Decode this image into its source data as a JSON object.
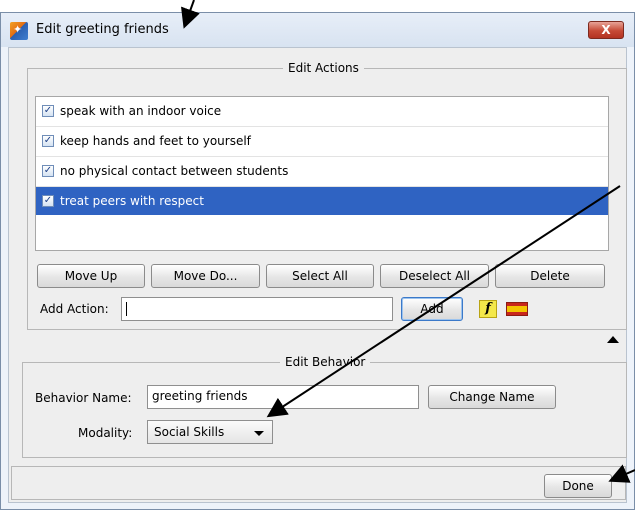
{
  "window": {
    "title": "Edit greeting friends",
    "close_label": "X"
  },
  "edit_actions": {
    "legend": "Edit Actions",
    "items": [
      {
        "label": "speak with an indoor voice",
        "checked": true,
        "selected": false
      },
      {
        "label": "keep hands and feet to yourself",
        "checked": true,
        "selected": false
      },
      {
        "label": "no physical contact between students",
        "checked": true,
        "selected": false
      },
      {
        "label": "treat peers with respect",
        "checked": true,
        "selected": true
      }
    ],
    "buttons": {
      "move_up": "Move Up",
      "move_down": "Move Do...",
      "select_all": "Select All",
      "deselect_all": "Deselect All",
      "delete": "Delete"
    },
    "add_action_label": "Add Action:",
    "add_action_value": "",
    "add_button": "Add",
    "function_icon": "f",
    "spanish_flag_icon": "spanish-flag-icon"
  },
  "edit_behavior": {
    "legend": "Edit Behavior",
    "name_label": "Behavior Name:",
    "name_value": "greeting friends",
    "change_name_button": "Change Name",
    "modality_label": "Modality:",
    "modality_value": "Social Skills"
  },
  "footer": {
    "done_button": "Done"
  },
  "colors": {
    "selection": "#2f63c2",
    "close_button": "#c64a36",
    "title_bar": "#dbe5f2"
  }
}
